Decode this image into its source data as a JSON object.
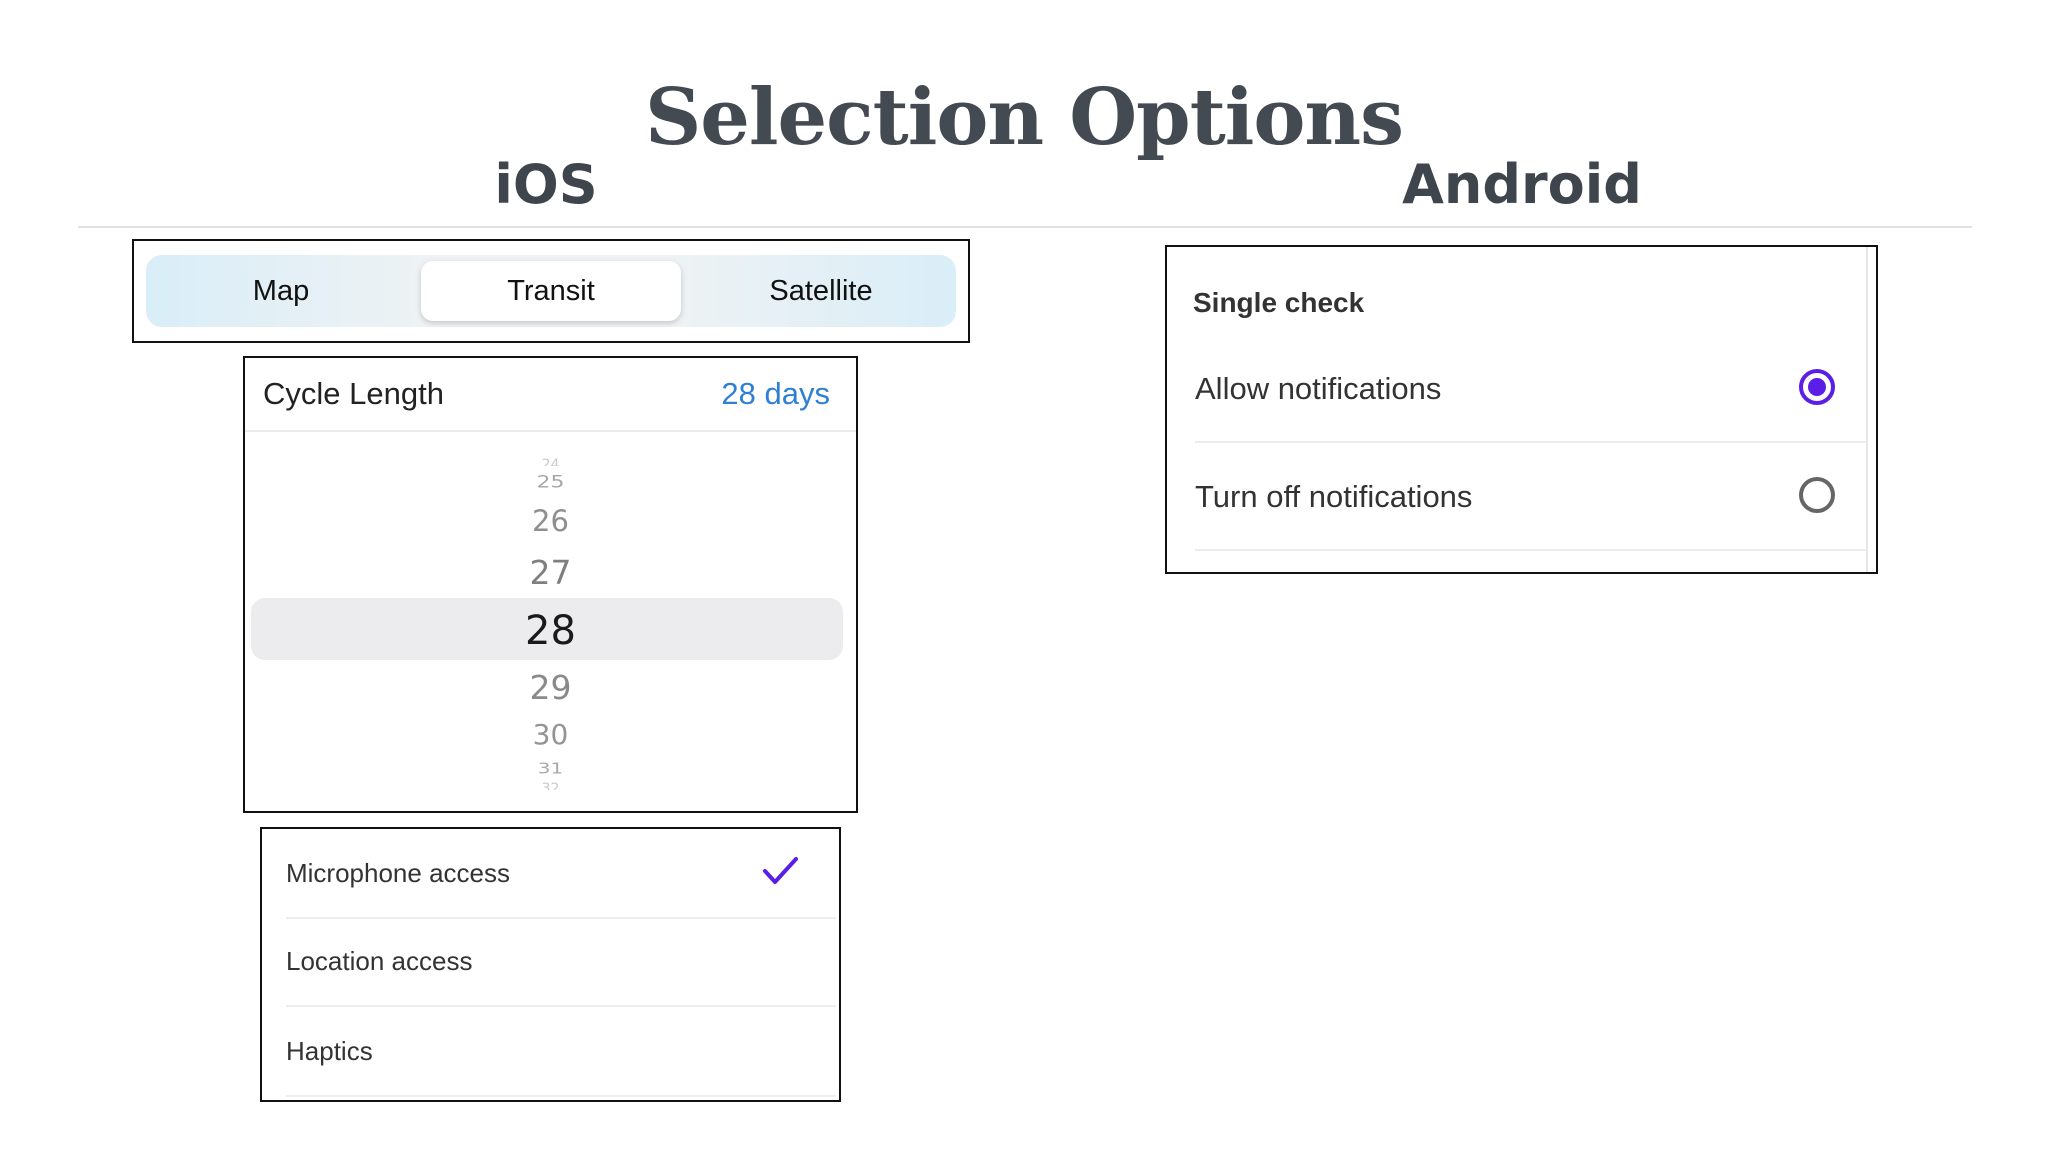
{
  "title": "Selection Options",
  "columns": {
    "ios": "iOS",
    "android": "Android"
  },
  "segmented_control": {
    "items": [
      "Map",
      "Transit",
      "Satellite"
    ],
    "selected": "Transit"
  },
  "picker": {
    "label": "Cycle Length",
    "value": "28 days",
    "numbers": [
      "24",
      "25",
      "26",
      "27",
      "28",
      "29",
      "30",
      "31",
      "32"
    ],
    "selected": "28"
  },
  "checklist": {
    "items": [
      {
        "label": "Microphone access",
        "checked": true
      },
      {
        "label": "Location access",
        "checked": false
      },
      {
        "label": "Haptics",
        "checked": false
      }
    ],
    "check_color": "#5b1ee6",
    "check_icon": "checkmark-icon"
  },
  "radio_group": {
    "section_label": "Single check",
    "options": [
      {
        "label": "Allow notifications",
        "selected": true
      },
      {
        "label": "Turn off notifications",
        "selected": false
      }
    ],
    "accent_color": "#5b1ee6"
  }
}
